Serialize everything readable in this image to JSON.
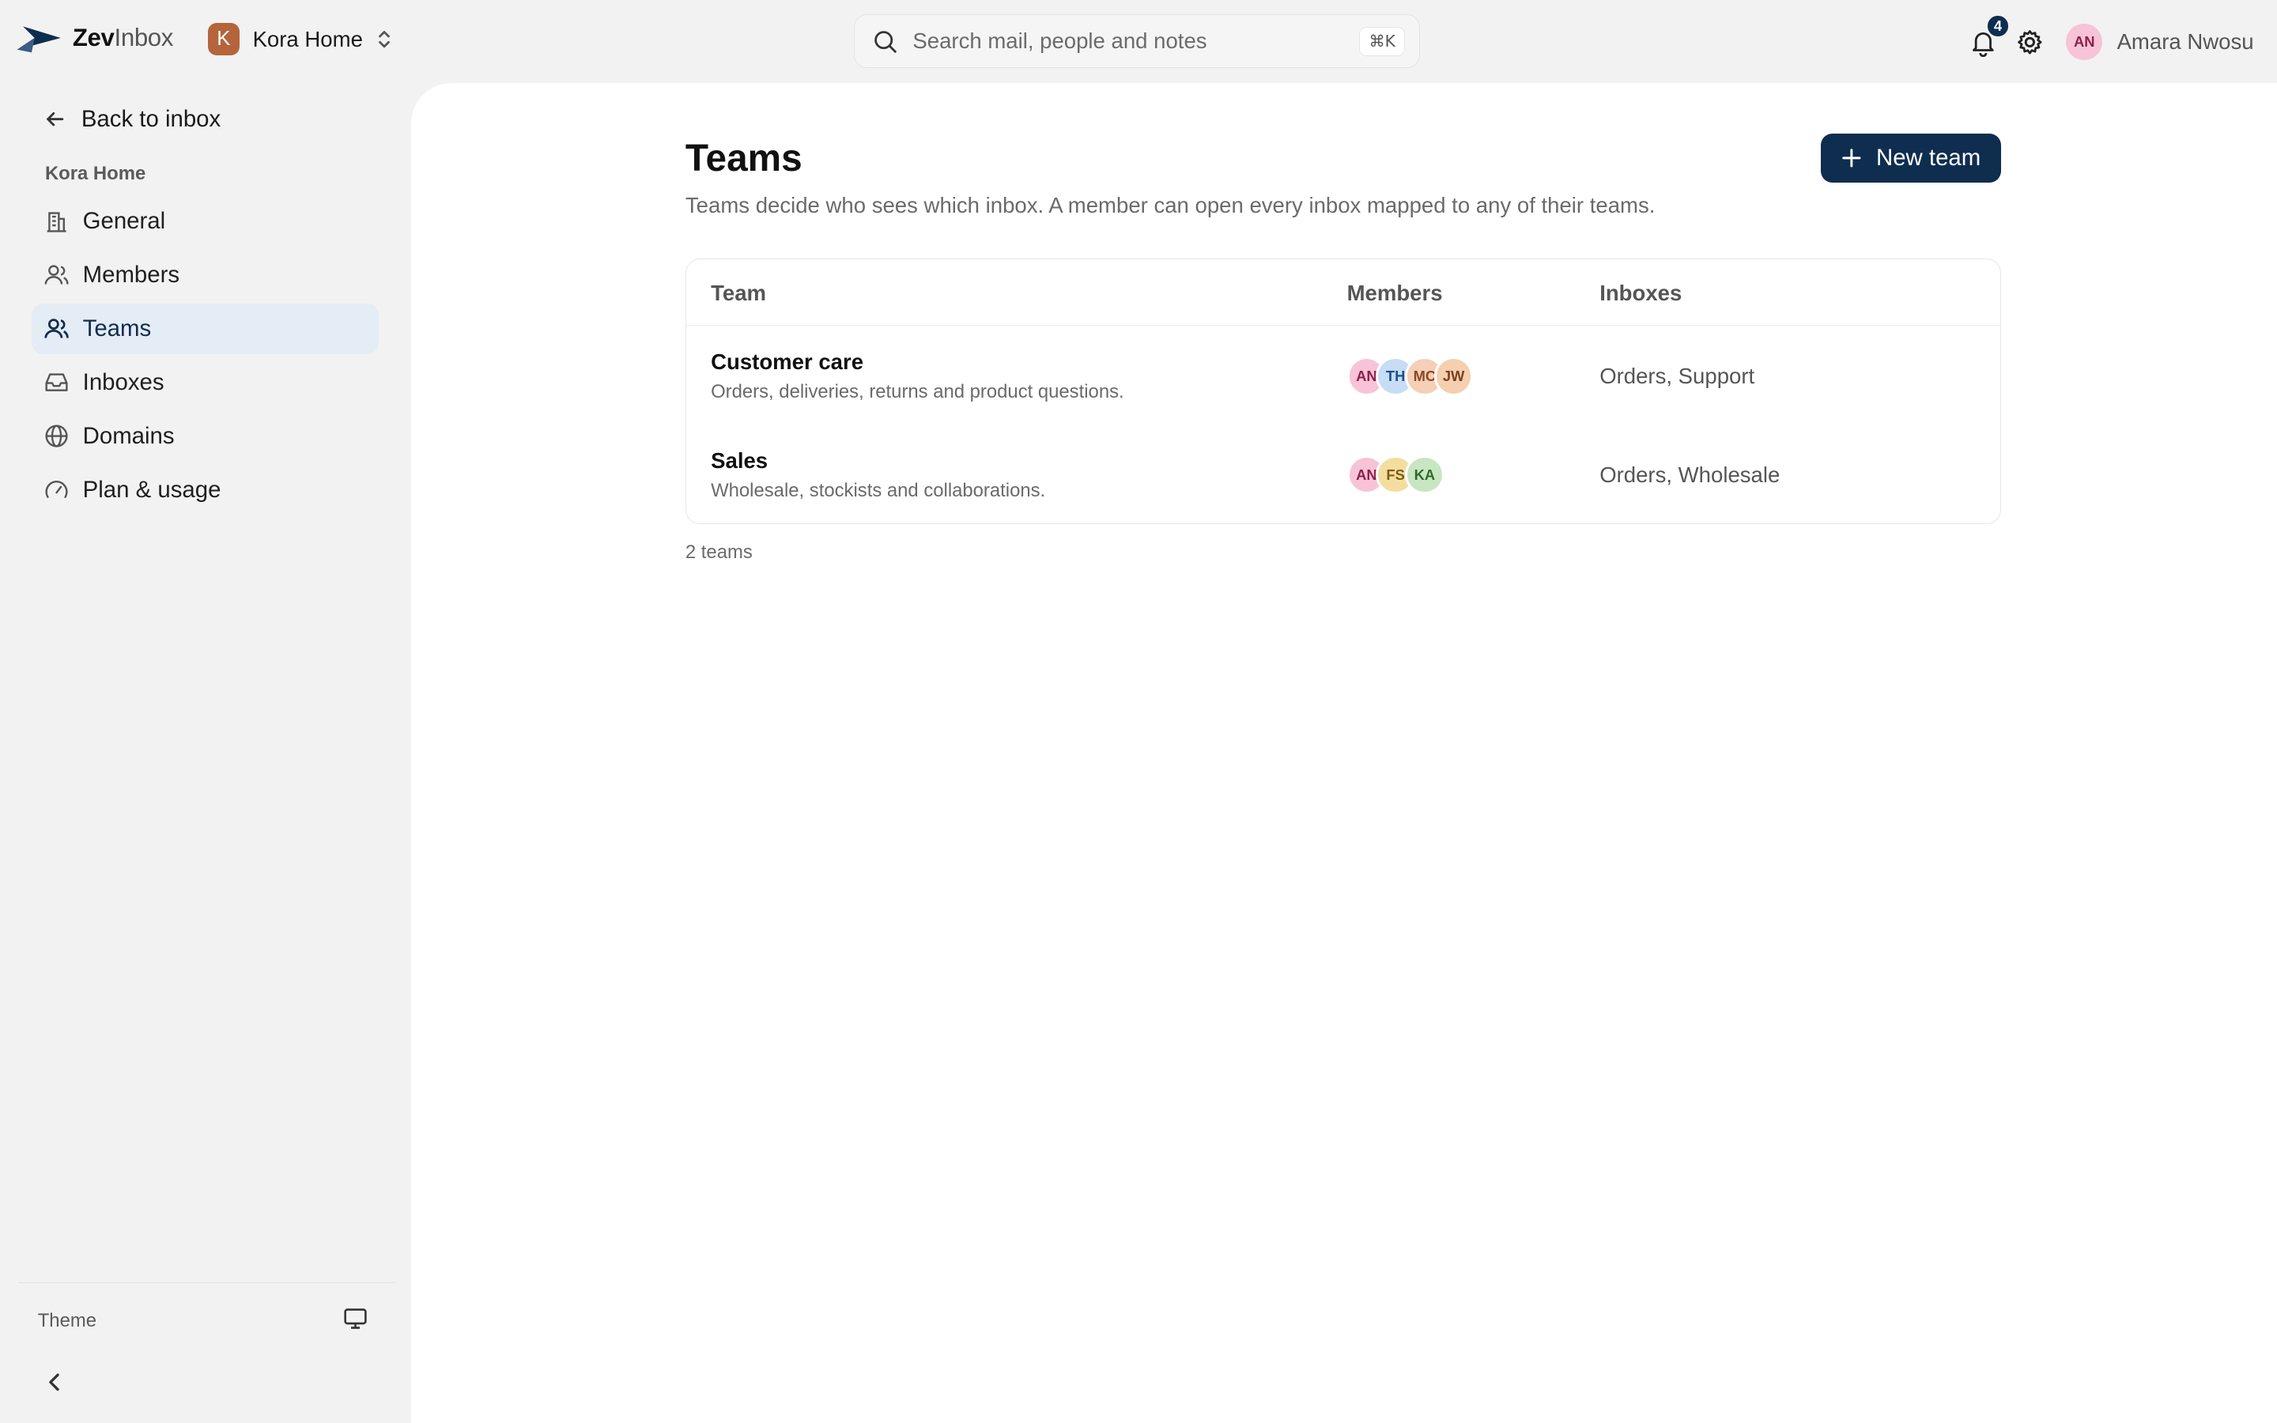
{
  "brand": {
    "name_bold": "Zev",
    "name_rest": "Inbox"
  },
  "workspace": {
    "initial": "K",
    "name": "Kora Home"
  },
  "search": {
    "placeholder": "Search mail, people and notes",
    "shortcut": "⌘K"
  },
  "notifications": {
    "count": "4"
  },
  "user": {
    "initials": "AN",
    "name": "Amara Nwosu"
  },
  "sidebar": {
    "back_label": "Back to inbox",
    "section_label": "Kora Home",
    "items": [
      {
        "label": "General",
        "icon": "building-icon"
      },
      {
        "label": "Members",
        "icon": "users-icon"
      },
      {
        "label": "Teams",
        "icon": "user-group-icon",
        "active": true
      },
      {
        "label": "Inboxes",
        "icon": "inbox-icon"
      },
      {
        "label": "Domains",
        "icon": "globe-icon"
      },
      {
        "label": "Plan & usage",
        "icon": "gauge-icon"
      }
    ],
    "theme_label": "Theme"
  },
  "page": {
    "title": "Teams",
    "description": "Teams decide who sees which inbox. A member can open every inbox mapped to any of their teams.",
    "new_button": "New team",
    "count": "2 teams"
  },
  "table": {
    "columns": [
      "Team",
      "Members",
      "Inboxes"
    ],
    "rows": [
      {
        "name": "Customer care",
        "description": "Orders, deliveries, returns and product questions.",
        "members": [
          {
            "initials": "AN",
            "bg": "#f7c3d6",
            "fg": "#8c1f4b"
          },
          {
            "initials": "TH",
            "bg": "#c7dcf5",
            "fg": "#1d4f86"
          },
          {
            "initials": "MC",
            "bg": "#f5cfb8",
            "fg": "#8a4a24"
          },
          {
            "initials": "JW",
            "bg": "#f5cfb0",
            "fg": "#7a4220"
          }
        ],
        "inboxes": "Orders, Support"
      },
      {
        "name": "Sales",
        "description": "Wholesale, stockists and collaborations.",
        "members": [
          {
            "initials": "AN",
            "bg": "#f7c3d6",
            "fg": "#8c1f4b"
          },
          {
            "initials": "FS",
            "bg": "#f3dea0",
            "fg": "#7a5c10"
          },
          {
            "initials": "KA",
            "bg": "#c8e6c2",
            "fg": "#2f6b2a"
          }
        ],
        "inboxes": "Orders, Wholesale"
      }
    ]
  },
  "colors": {
    "accent": "#0f2d4f",
    "active_bg": "#e4ecf5",
    "workspace_badge": "#b5643b"
  }
}
